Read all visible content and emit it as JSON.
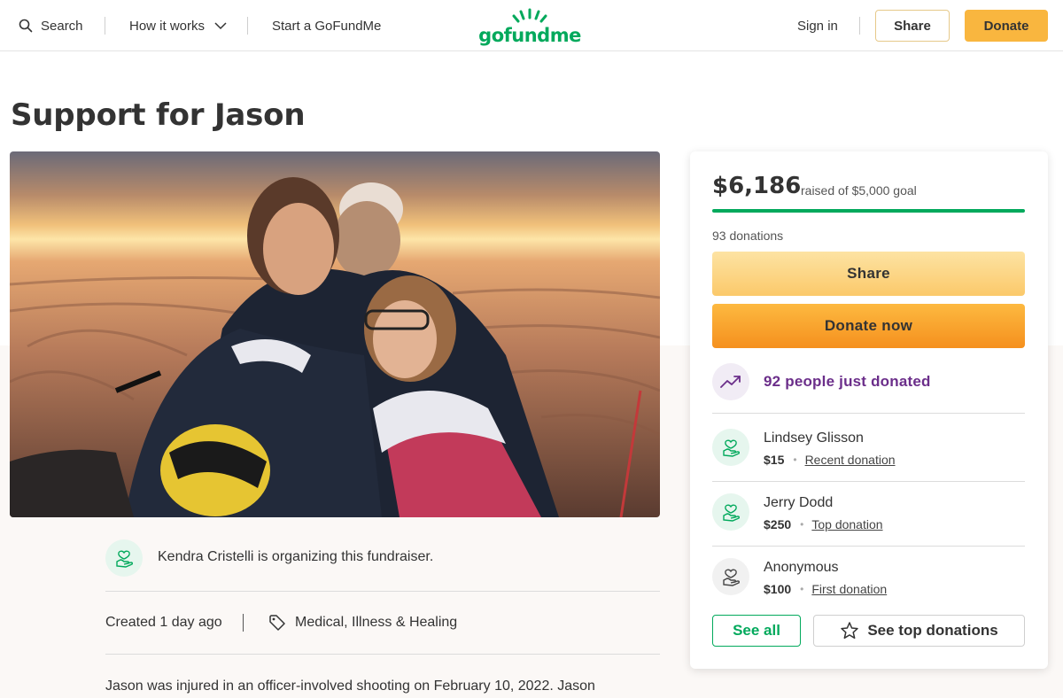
{
  "header": {
    "search_label": "Search",
    "how_it_works_label": "How it works",
    "start_label": "Start a GoFundMe",
    "logo_text": "gofundme",
    "sign_in_label": "Sign in",
    "share_label": "Share",
    "donate_label": "Donate"
  },
  "campaign": {
    "title": "Support for Jason",
    "organizer_text": "Kendra Cristelli is organizing this fundraiser.",
    "created_text": "Created 1 day ago",
    "category": "Medical, Illness & Healing",
    "story_start": "Jason was injured in an officer-involved shooting on February 10, 2022. Jason"
  },
  "donation_card": {
    "raised_amount": "$6,186",
    "raised_label": "raised of $5,000 goal",
    "progress_fraction": 1.0,
    "donations_count": "93 donations",
    "share_label": "Share",
    "donate_now_label": "Donate now",
    "trend_text": "92 people just donated",
    "donors": [
      {
        "name": "Lindsey Glisson",
        "amount": "$15",
        "tag": "Recent donation"
      },
      {
        "name": "Jerry Dodd",
        "amount": "$250",
        "tag": "Top donation"
      },
      {
        "name": "Anonymous",
        "amount": "$100",
        "tag": "First donation"
      }
    ],
    "see_all_label": "See all",
    "see_top_label": "See top donations"
  },
  "colors": {
    "brand_green": "#02a95c",
    "donate_gold": "#f9b63f",
    "trend_purple": "#6b2e8a"
  },
  "icons": {
    "search": "search-icon",
    "chevron": "chevron-down-icon",
    "tag": "tag-icon",
    "trend": "trending-up-icon",
    "donor": "heart-hand-icon",
    "star": "star-icon"
  }
}
